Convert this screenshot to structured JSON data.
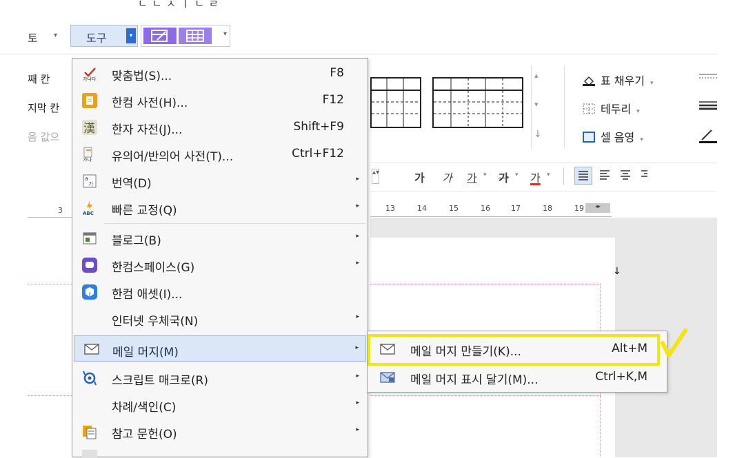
{
  "menubar": {
    "partial_top": "ㄴ ㄴ ㅅ ㅣ  ㄴ ㄹ",
    "review_tab": "토",
    "tools_tab": "도구"
  },
  "left_partial": {
    "line1": "째 칸",
    "line2": "지막 칸",
    "line3": "음 값으",
    "ruler_num": "3"
  },
  "right_tools": {
    "table_fill": "표 채우기",
    "border": "테두리",
    "cell_shade": "셀 음영"
  },
  "format_bar": {
    "char1": "가",
    "char2": "가",
    "char3": "가",
    "char4": "가",
    "char5": "가"
  },
  "ruler_ticks": [
    "13",
    "14",
    "15",
    "16",
    "17",
    "18",
    "19"
  ],
  "menu": {
    "items": [
      {
        "label": "맞춤법(S)...",
        "shortcut": "F8"
      },
      {
        "label": "한컴 사전(H)...",
        "shortcut": "F12"
      },
      {
        "label": "한자 자전(J)...",
        "shortcut": "Shift+F9"
      },
      {
        "label": "유의어/반의어 사전(T)...",
        "shortcut": "Ctrl+F12"
      },
      {
        "label": "번역(D)"
      },
      {
        "label": "빠른 교정(Q)"
      },
      {
        "label": "블로그(B)"
      },
      {
        "label": "한컴스페이스(G)"
      },
      {
        "label": "한컴 애셋(I)..."
      },
      {
        "label": "인터넷 우체국(N)"
      },
      {
        "label": "메일 머지(M)"
      },
      {
        "label": "스크립트 매크로(R)"
      },
      {
        "label": "차례/색인(C)"
      },
      {
        "label": "참고 문헌(O)"
      }
    ]
  },
  "submenu": {
    "items": [
      {
        "label": "메일 머지 만들기(K)...",
        "shortcut": "Alt+M"
      },
      {
        "label": "메일 머지 표시 달기(M)...",
        "shortcut": "Ctrl+K,M"
      }
    ]
  },
  "colors": {
    "highlight": "#dbe6f6",
    "annotation": "#f4e316",
    "tools_accent": "#2f6bd1"
  }
}
